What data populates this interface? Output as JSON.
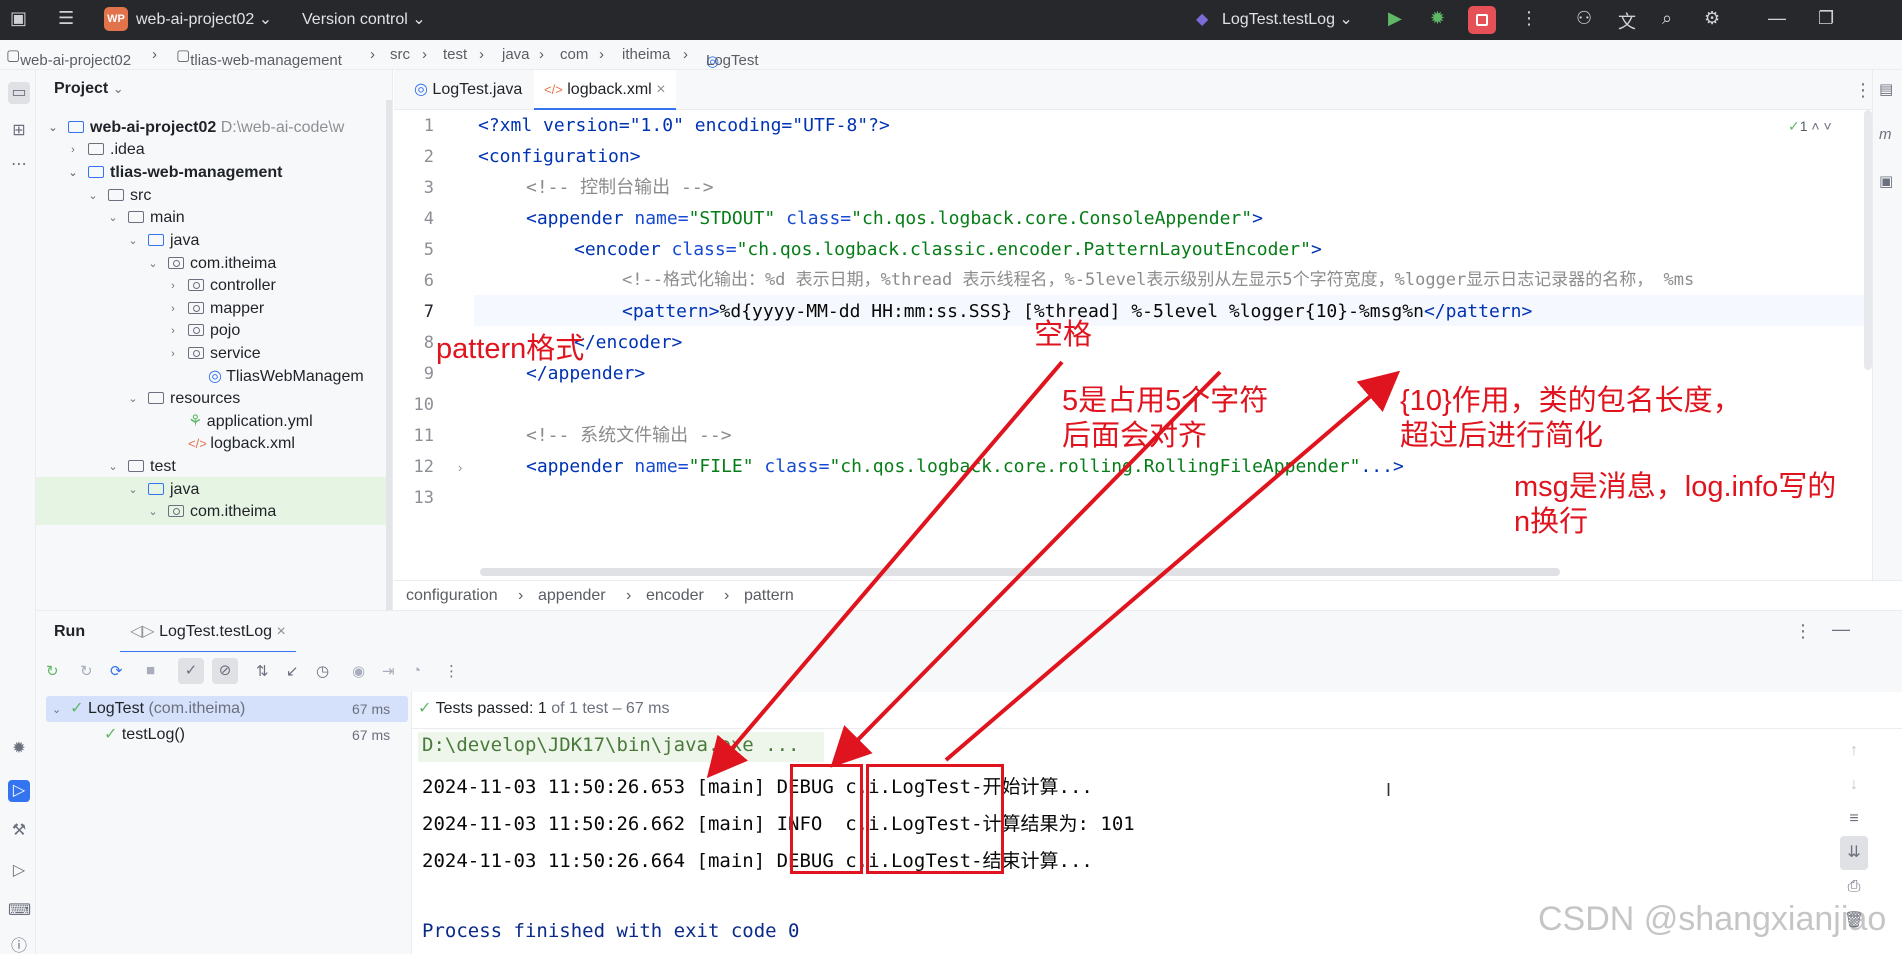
{
  "titlebar": {
    "project_badge": "WP",
    "project_name": "web-ai-project02",
    "vcs": "Version control",
    "run_config": "LogTest.testLog"
  },
  "breadcrumb": [
    "web-ai-project02",
    "tlias-web-management",
    "src",
    "test",
    "java",
    "com",
    "itheima",
    "LogTest"
  ],
  "project_panel": {
    "title": "Project",
    "items": [
      {
        "label": "web-ai-project02",
        "extra": "D:\\web-ai-code\\w"
      },
      {
        "label": ".idea"
      },
      {
        "label": "tlias-web-management"
      },
      {
        "label": "src"
      },
      {
        "label": "main"
      },
      {
        "label": "java"
      },
      {
        "label": "com.itheima"
      },
      {
        "label": "controller"
      },
      {
        "label": "mapper"
      },
      {
        "label": "pojo"
      },
      {
        "label": "service"
      },
      {
        "label": "TliasWebManagem"
      },
      {
        "label": "resources"
      },
      {
        "label": "application.yml"
      },
      {
        "label": "logback.xml"
      },
      {
        "label": "test"
      },
      {
        "label": "java"
      },
      {
        "label": "com.itheima"
      }
    ]
  },
  "editor": {
    "tabs": [
      "LogTest.java",
      "logback.xml"
    ],
    "inspection_count": "1",
    "line_numbers": [
      "1",
      "2",
      "3",
      "4",
      "5",
      "6",
      "7",
      "8",
      "9",
      "10",
      "11",
      "12",
      "13"
    ],
    "lines": {
      "l1": "<?xml version=\"1.0\" encoding=\"UTF-8\"?>",
      "l2": "<configuration>",
      "l3": "<!-- 控制台输出 -->",
      "l4a": "<appender ",
      "l4b": "name=",
      "l4c": "\"STDOUT\" ",
      "l4d": "class=",
      "l4e": "\"ch.qos.logback.core.ConsoleAppender\"",
      "l4f": ">",
      "l5a": "<encoder ",
      "l5b": "class=",
      "l5c": "\"ch.qos.logback.classic.encoder.PatternLayoutEncoder\"",
      "l5d": ">",
      "l6": "<!--格式化输出：%d 表示日期，%thread 表示线程名，%-5level表示级别从左显示5个字符宽度，%logger显示日志记录器的名称， %ms",
      "l7a": "<pattern>",
      "l7b": "%d{yyyy-MM-dd HH:mm:ss.SSS} [%thread] %-5level %logger{10}-%msg%n",
      "l7c": "</pattern>",
      "l8": "</encoder>",
      "l9": "</appender>",
      "l11": "<!-- 系统文件输出 -->",
      "l12a": "<appender ",
      "l12b": "name=",
      "l12c": "\"FILE\" ",
      "l12d": "class=",
      "l12e": "\"ch.qos.logback.core.rolling.RollingFileAppender\"",
      "l12f": "...>"
    },
    "breadcrumb": [
      "configuration",
      "appender",
      "encoder",
      "pattern"
    ]
  },
  "run_panel": {
    "title": "Run",
    "tab": "LogTest.testLog",
    "tests": [
      {
        "name": "LogTest",
        "pkg": "(com.itheima)",
        "time": "67 ms"
      },
      {
        "name": "testLog()",
        "time": "67 ms"
      }
    ],
    "status_prefix": "Tests passed:",
    "status_count": "1",
    "status_suffix": "of 1 test – 67 ms",
    "console": [
      "D:\\develop\\JDK17\\bin\\java.exe ...",
      "2024-11-03 11:50:26.653 [main] DEBUG c.i.LogTest-开始计算...",
      "2024-11-03 11:50:26.662 [main] INFO  c.i.LogTest-计算结果为: 101",
      "2024-11-03 11:50:26.664 [main] DEBUG c.i.LogTest-结束计算...",
      "",
      "Process finished with exit code 0"
    ]
  },
  "annotations": {
    "pattern_format": "pattern格式",
    "space": "空格",
    "five_1": "5是占用5个字符",
    "five_2": "后面会对齐",
    "ten_1": "{10}作用，类的包名长度，",
    "ten_2": "超过后进行简化",
    "msg_1": "msg是消息，log.info写的",
    "msg_2": "n换行",
    "color": "#e0141e"
  },
  "watermark": "CSDN @shangxianjiao"
}
